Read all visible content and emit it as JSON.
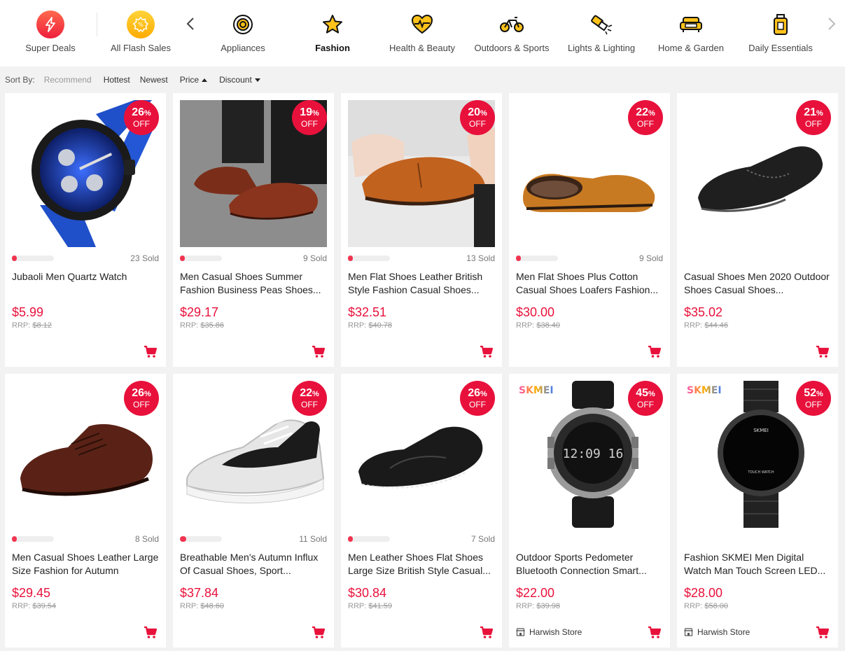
{
  "categories": [
    {
      "label": "Super Deals",
      "icon": "lightning-icon",
      "active": false
    },
    {
      "label": "All Flash Sales",
      "icon": "flash-sale-badge-icon",
      "active": false
    },
    {
      "label": "Appliances",
      "icon": "washing-machine-icon",
      "active": false
    },
    {
      "label": "Fashion",
      "icon": "star-icon",
      "active": true
    },
    {
      "label": "Health & Beauty",
      "icon": "heart-pulse-icon",
      "active": false
    },
    {
      "label": "Outdoors & Sports",
      "icon": "bicycle-icon",
      "active": false
    },
    {
      "label": "Lights & Lighting",
      "icon": "flashlight-icon",
      "active": false
    },
    {
      "label": "Home & Garden",
      "icon": "sofa-icon",
      "active": false
    },
    {
      "label": "Daily Essentials",
      "icon": "bottle-icon",
      "active": false
    }
  ],
  "nav": {
    "prev_icon": "chevron-left-icon",
    "next_icon": "chevron-right-icon"
  },
  "sort": {
    "label": "Sort By:",
    "options": [
      "Recommend",
      "Hottest",
      "Newest",
      "Price",
      "Discount"
    ]
  },
  "products": [
    {
      "title": "Jubaoli Men Quartz Watch",
      "price": "$5.99",
      "rrp_label": "RRP:",
      "rrp": "$8.12",
      "discount": "26",
      "sold": "23 Sold",
      "sold_progress": 0.12,
      "store": "",
      "image": "blue-quartz-watch",
      "brand": ""
    },
    {
      "title": "Men Casual Shoes Summer Fashion Business Peas Shoes...",
      "price": "$29.17",
      "rrp_label": "RRP:",
      "rrp": "$35.86",
      "discount": "19",
      "sold": "9 Sold",
      "sold_progress": 0.12,
      "store": "",
      "image": "brown-loafer",
      "brand": ""
    },
    {
      "title": "Men Flat Shoes Leather British Style Fashion Casual Shoes...",
      "price": "$32.51",
      "rrp_label": "RRP:",
      "rrp": "$40.78",
      "discount": "20",
      "sold": "13 Sold",
      "sold_progress": 0.12,
      "store": "",
      "image": "tan-leather-loafer",
      "brand": ""
    },
    {
      "title": "Men Flat Shoes Plus Cotton Casual Shoes Loafers Fashion...",
      "price": "$30.00",
      "rrp_label": "RRP:",
      "rrp": "$38.40",
      "discount": "22",
      "sold": "9 Sold",
      "sold_progress": 0.12,
      "store": "",
      "image": "fur-lined-loafer",
      "brand": ""
    },
    {
      "title": "Casual Shoes Men 2020 Outdoor Shoes Casual Shoes...",
      "price": "$35.02",
      "rrp_label": "RRP:",
      "rrp": "$44.46",
      "discount": "21",
      "sold": "",
      "sold_progress": 0,
      "store": "",
      "image": "black-slip-on",
      "brand": ""
    },
    {
      "title": "Men Casual Shoes Leather Large Size Fashion for Autumn",
      "price": "$29.45",
      "rrp_label": "RRP:",
      "rrp": "$39.54",
      "discount": "26",
      "sold": "8 Sold",
      "sold_progress": 0.12,
      "store": "",
      "image": "brown-lace-up",
      "brand": ""
    },
    {
      "title": "Breathable Men's Autumn Influx Of Casual Shoes, Sport...",
      "price": "$37.84",
      "rrp_label": "RRP:",
      "rrp": "$48.60",
      "discount": "22",
      "sold": "11 Sold",
      "sold_progress": 0.15,
      "store": "",
      "image": "white-black-sneaker",
      "brand": ""
    },
    {
      "title": "Men Leather Shoes Flat Shoes Large Size British Style Casual...",
      "price": "$30.84",
      "rrp_label": "RRP:",
      "rrp": "$41.59",
      "discount": "26",
      "sold": "7 Sold",
      "sold_progress": 0.06,
      "store": "",
      "image": "black-leather-loafer",
      "brand": ""
    },
    {
      "title": "Outdoor Sports Pedometer Bluetooth Connection Smart...",
      "price": "$22.00",
      "rrp_label": "RRP:",
      "rrp": "$39.98",
      "discount": "45",
      "sold": "",
      "sold_progress": 0,
      "store": "Harwish Store",
      "image": "digital-sports-watch",
      "brand": "SKMEI"
    },
    {
      "title": "Fashion SKMEI Men Digital Watch Man Touch Screen LED...",
      "price": "$28.00",
      "rrp_label": "RRP:",
      "rrp": "$58.00",
      "discount": "52",
      "sold": "",
      "sold_progress": 0,
      "store": "Harwish Store",
      "image": "led-touch-watch",
      "brand": "SKMEI"
    }
  ],
  "badge_suffix": "%",
  "badge_off": "OFF",
  "colors": {
    "accent": "#e8113b",
    "progress": "#f0344f",
    "super_deals": "#f43b47",
    "flash": "#ffc21a"
  }
}
